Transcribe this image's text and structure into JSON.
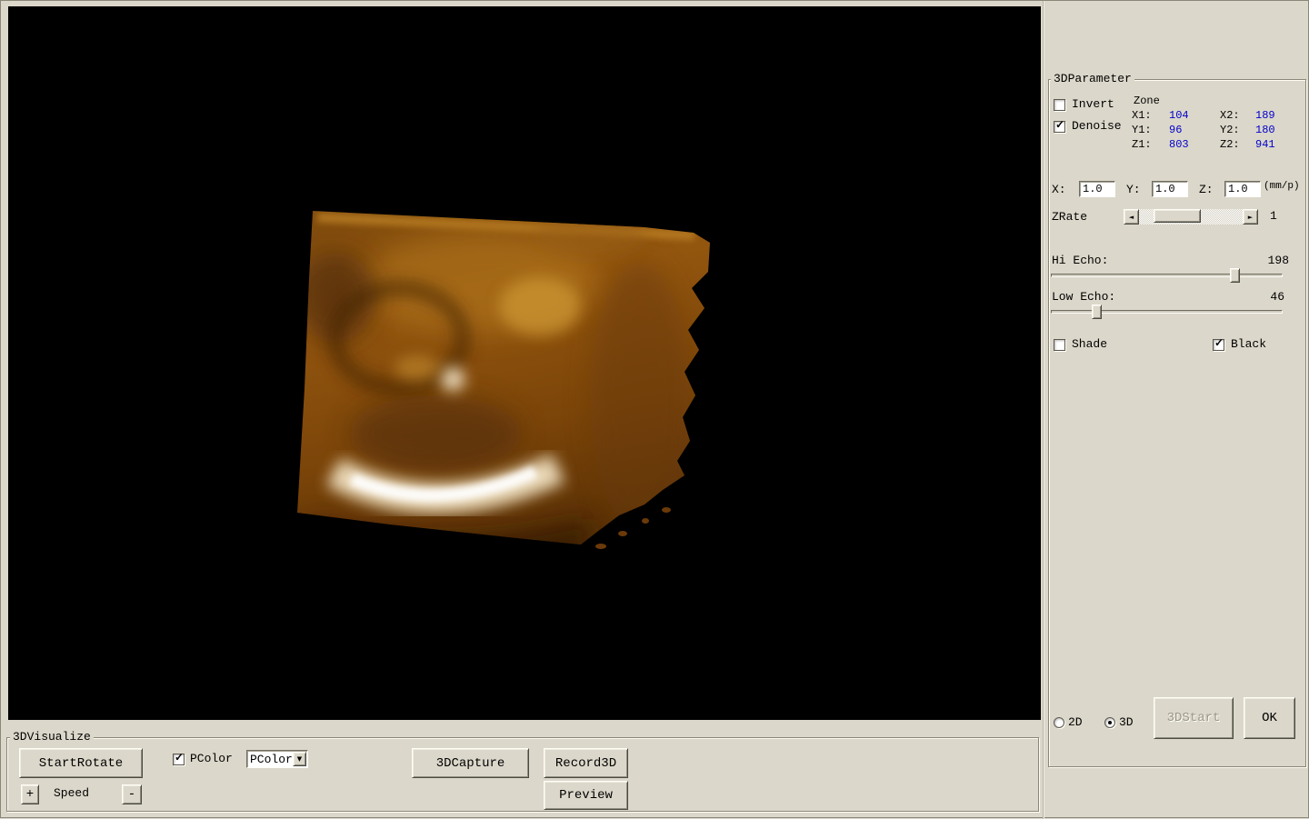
{
  "colors": {
    "window_bg": "#dbd7ca",
    "viewport_bg": "#000000",
    "zone_value_blue": "#0000cc"
  },
  "icons": {
    "check": "✓",
    "left_arrow": "◄",
    "right_arrow": "►",
    "dropdown_arrow": "▼"
  },
  "param": {
    "title": "3DParameter",
    "invert": "Invert",
    "denoise": "Denoise",
    "zone_title": "Zone",
    "x1_label": "X1:",
    "x1_value": "104",
    "x2_label": "X2:",
    "x2_value": "189",
    "y1_label": "Y1:",
    "y1_value": "96",
    "y2_label": "Y2:",
    "y2_value": "180",
    "z1_label": "Z1:",
    "z1_value": "803",
    "z2_label": "Z2:",
    "z2_value": "941",
    "x_label": "X:",
    "x_scale": "1.0",
    "y_label": "Y:",
    "y_scale": "1.0",
    "z_label": "Z:",
    "z_scale": "1.0",
    "unit": "(mm/p)",
    "zrate_label": "ZRate",
    "zrate_value": "1",
    "hi_echo_label": "Hi Echo:",
    "hi_echo_value": "198",
    "low_echo_label": "Low Echo:",
    "low_echo_value": "46",
    "shade": "Shade",
    "black": "Black",
    "mode_2d": "2D",
    "mode_3d": "3D",
    "start3d": "3DStart",
    "ok": "OK"
  },
  "visualize": {
    "title": "3DVisualize",
    "start_rotate": "StartRotate",
    "pcolor_check": "PColor",
    "pcolor_select": "PColor",
    "capture": "3DCapture",
    "record": "Record3D",
    "preview": "Preview",
    "plus": "+",
    "speed": "Speed",
    "minus": "-"
  }
}
